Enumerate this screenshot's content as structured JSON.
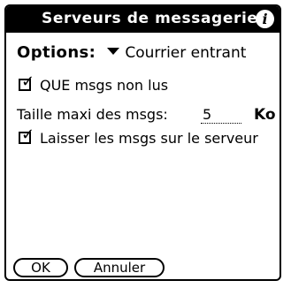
{
  "dialog": {
    "title": "Serveurs de messagerie",
    "info_icon": "i"
  },
  "options": {
    "label": "Options:",
    "selected": "Courrier entrant"
  },
  "settings": {
    "unread_only_label": "QUE msgs non lus",
    "unread_only_checked": true,
    "max_size_label": "Taille maxi des msgs:",
    "max_size_value": "5",
    "max_size_unit": "Ko",
    "leave_on_server_label": "Laisser les msgs sur le serveur",
    "leave_on_server_checked": true,
    "check_glyph": "✓"
  },
  "buttons": {
    "ok": "OK",
    "cancel": "Annuler"
  }
}
